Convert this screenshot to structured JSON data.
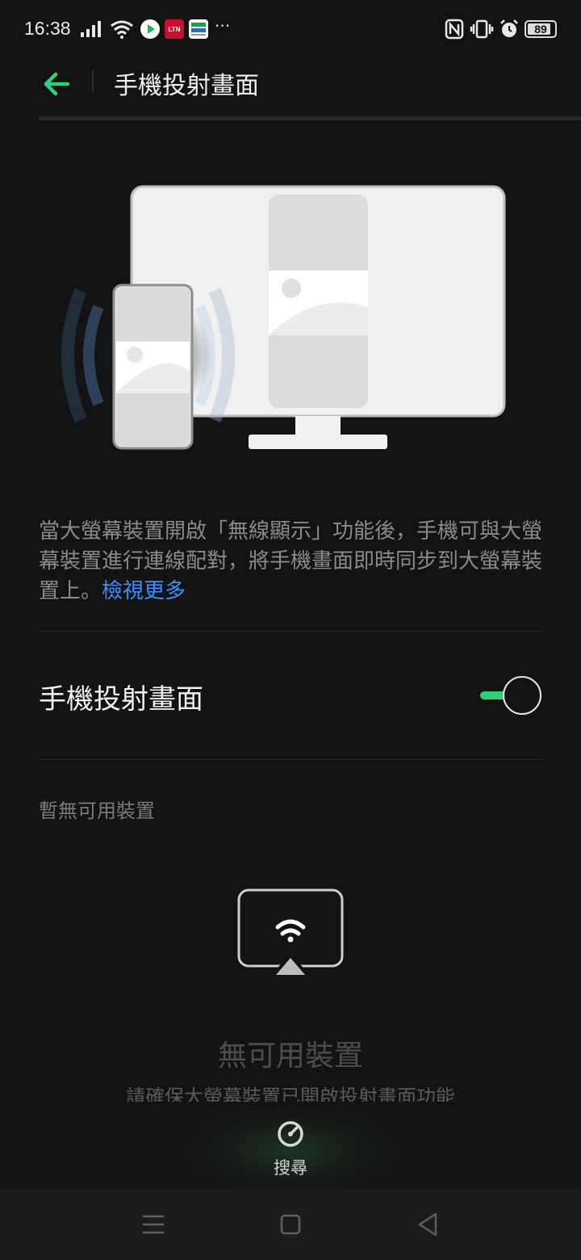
{
  "status_bar": {
    "time": "16:38",
    "battery": "89",
    "battery_level": 0.89,
    "more_indicator": "···",
    "app_icons": [
      "play-icon",
      "ltn-icon",
      "news-app-icon"
    ],
    "ltn_label": "LTN",
    "icons": [
      "signal-icon",
      "wifi-icon",
      "nfc-icon",
      "vibrate-icon",
      "alarm-icon",
      "battery-icon"
    ]
  },
  "header": {
    "title": "手機投射畫面",
    "back_icon": "back-arrow-icon"
  },
  "colors": {
    "accent": "#2fd07a",
    "link": "#3d8ef8",
    "background": "#131313"
  },
  "description": {
    "text": "當大螢幕裝置開啟「無線顯示」功能後，手機可與大螢幕裝置進行連線配對，將手機畫面即時同步到大螢幕裝置上。",
    "link": "檢視更多"
  },
  "toggle": {
    "label": "手機投射畫面",
    "enabled": true
  },
  "devices": {
    "section_label": "暫無可用裝置",
    "empty_icon": "cast-screen-icon",
    "empty_title": "無可用裝置",
    "empty_subtitle": "請確保大螢幕裝置已開啟投射畫面功能"
  },
  "search": {
    "label": "搜尋",
    "icon": "search-radar-icon"
  },
  "nav": {
    "icons": [
      "menu-icon",
      "home-icon",
      "back-icon"
    ]
  }
}
